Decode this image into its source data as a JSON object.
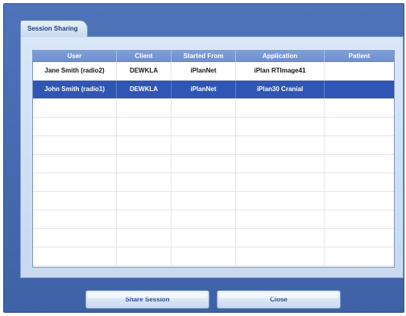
{
  "tab": {
    "label": "Session Sharing"
  },
  "table": {
    "headers": [
      "User",
      "Client",
      "Started From",
      "Application",
      "Patient"
    ],
    "rows": [
      {
        "user": "Jane Smith (radio2)",
        "client": "DEWKLA",
        "started_from": "iPlanNet",
        "application": "iPlan RTImage41",
        "patient": ""
      },
      {
        "user": "John Smith (radio1)",
        "client": "DEWKLA",
        "started_from": "iPlanNet",
        "application": "iPlan30 Cranial",
        "patient": ""
      }
    ]
  },
  "buttons": {
    "share_session": "Share Session",
    "close": "Close"
  },
  "colors": {
    "window_blue": "#4f73b8",
    "selected_row": "#2f56b4",
    "header_blue": "#7f9fda"
  }
}
